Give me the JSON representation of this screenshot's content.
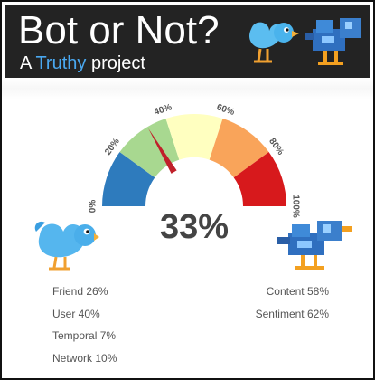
{
  "header": {
    "title": "Bot or Not?",
    "subtitle_prefix": "A",
    "subtitle_highlight": "Truthy",
    "subtitle_suffix": "project",
    "highlight_color": "#4aa8f0"
  },
  "gauge": {
    "score": 33,
    "score_text": "33%",
    "scale_max": 100,
    "tick_labels": [
      "0%",
      "20%",
      "40%",
      "60%",
      "80%",
      "100%"
    ],
    "band_colors": [
      "#2e7bbd",
      "#a8d890",
      "#ffffc0",
      "#f9a45a",
      "#d7191c"
    ],
    "needle_color": "#c0202a"
  },
  "left_scores": [
    {
      "text": "Friend 26%"
    },
    {
      "text": "User 40%"
    },
    {
      "text": "Temporal 7%"
    },
    {
      "text": "Network 10%"
    }
  ],
  "right_scores": [
    {
      "text": "Content 58%"
    },
    {
      "text": "Sentiment 62%"
    }
  ],
  "icons": {
    "left_bird": "twitter-bird-icon",
    "right_bird": "robot-bird-icon"
  }
}
